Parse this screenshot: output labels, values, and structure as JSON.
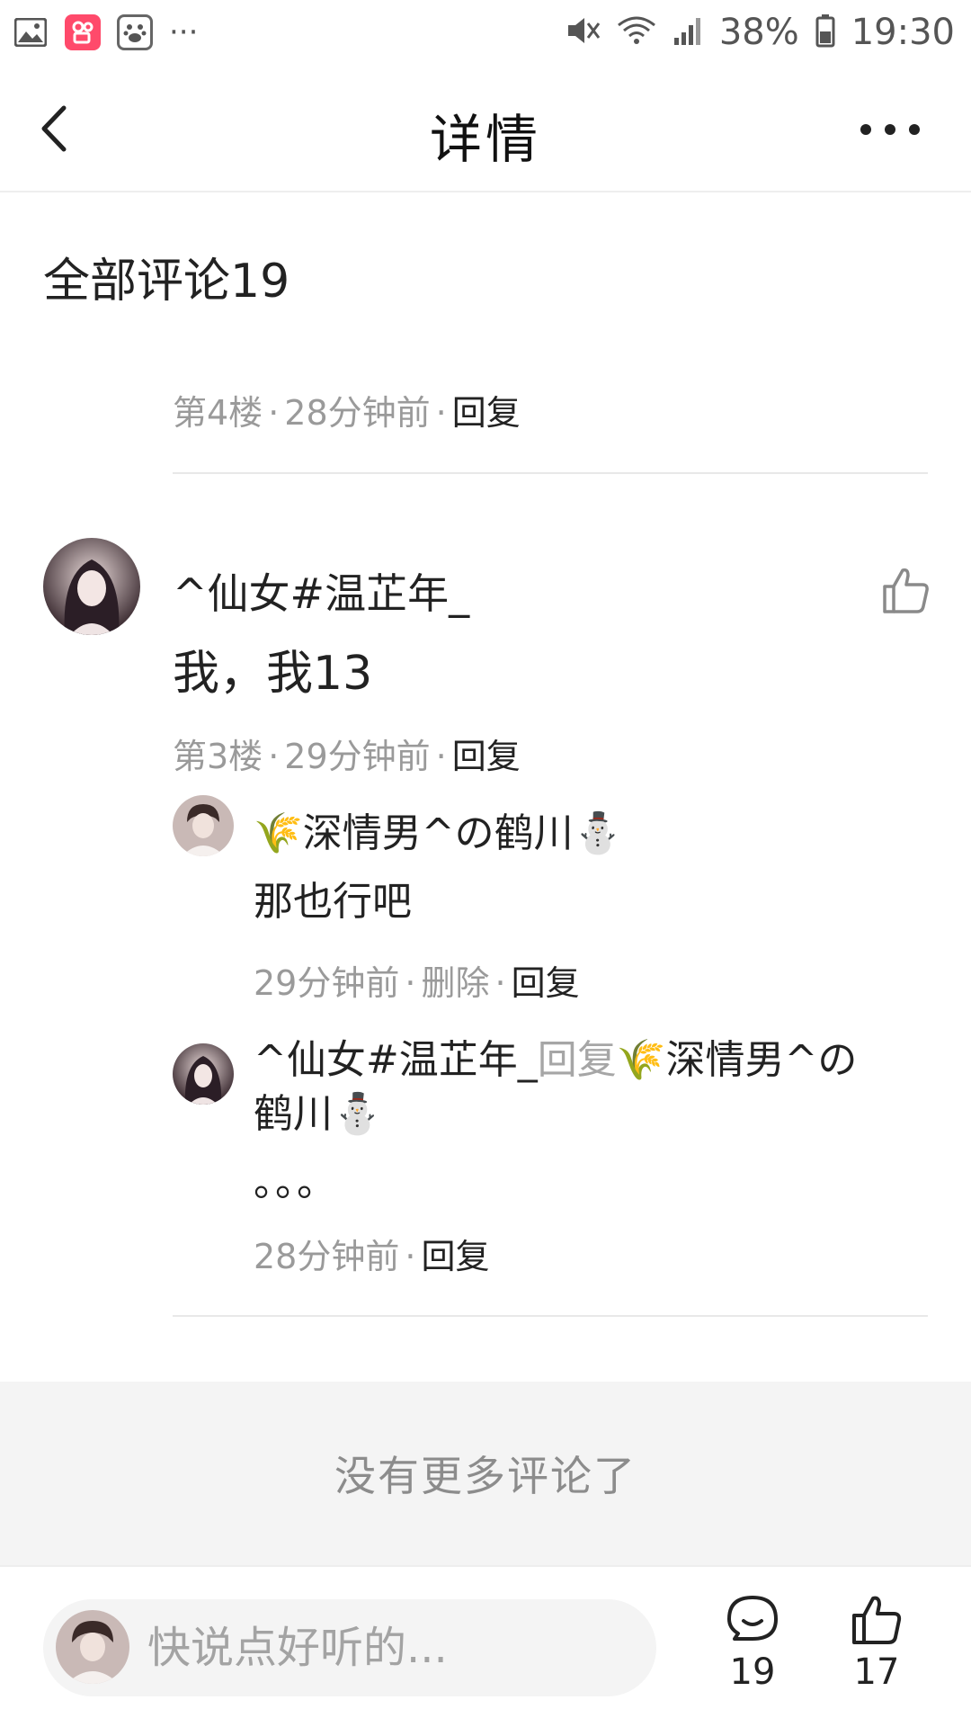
{
  "status_bar": {
    "battery": "38%",
    "time": "19:30",
    "overflow": "···"
  },
  "header": {
    "title": "详情"
  },
  "comments_section": {
    "title": "全部评论19"
  },
  "prev_comment_meta": {
    "floor": "第4楼",
    "time": "28分钟前",
    "reply": "回复"
  },
  "comment": {
    "username": "^仙女#温芷年_",
    "text": "我，我13",
    "floor": "第3楼",
    "time": "29分钟前",
    "reply": "回复"
  },
  "replies": [
    {
      "prefix_emoji": "🌾",
      "name": "深情男^の鹤川",
      "suffix_emoji": "⛄",
      "text": "那也行吧",
      "time": "29分钟前",
      "delete": "删除",
      "reply": "回复"
    },
    {
      "name": "^仙女#温芷年_",
      "reply_word": "回复",
      "target_prefix_emoji": "🌾",
      "target_line1": "深情男^の",
      "target_line2": "鹤川",
      "target_suffix_emoji": "⛄",
      "text": "。。。",
      "time": "28分钟前",
      "reply": "回复"
    }
  ],
  "no_more": "没有更多评论了",
  "bottom_bar": {
    "input_placeholder": "快说点好听的...",
    "comment_count": "19",
    "like_count": "17"
  }
}
